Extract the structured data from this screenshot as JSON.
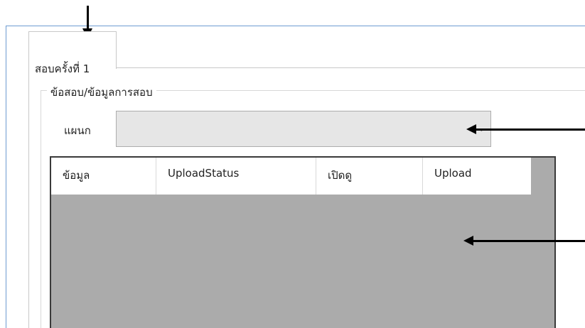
{
  "tab": {
    "label": "สอบครั้งที่ 1"
  },
  "groupbox": {
    "title": "ข้อสอบ/ข้อมูลการสอบ"
  },
  "department": {
    "label": "แผนก",
    "value": ""
  },
  "grid": {
    "columns": [
      "ข้อมูล",
      "UploadStatus",
      "เปิดดู",
      "Upload"
    ],
    "rows": []
  },
  "annotations": {
    "arrows": [
      "arrow-to-tab",
      "arrow-to-department-combo",
      "arrow-to-grid"
    ]
  },
  "colors": {
    "window_border": "#6d9bd1",
    "grid_background": "#ababab",
    "combo_background": "#e6e6e6"
  }
}
